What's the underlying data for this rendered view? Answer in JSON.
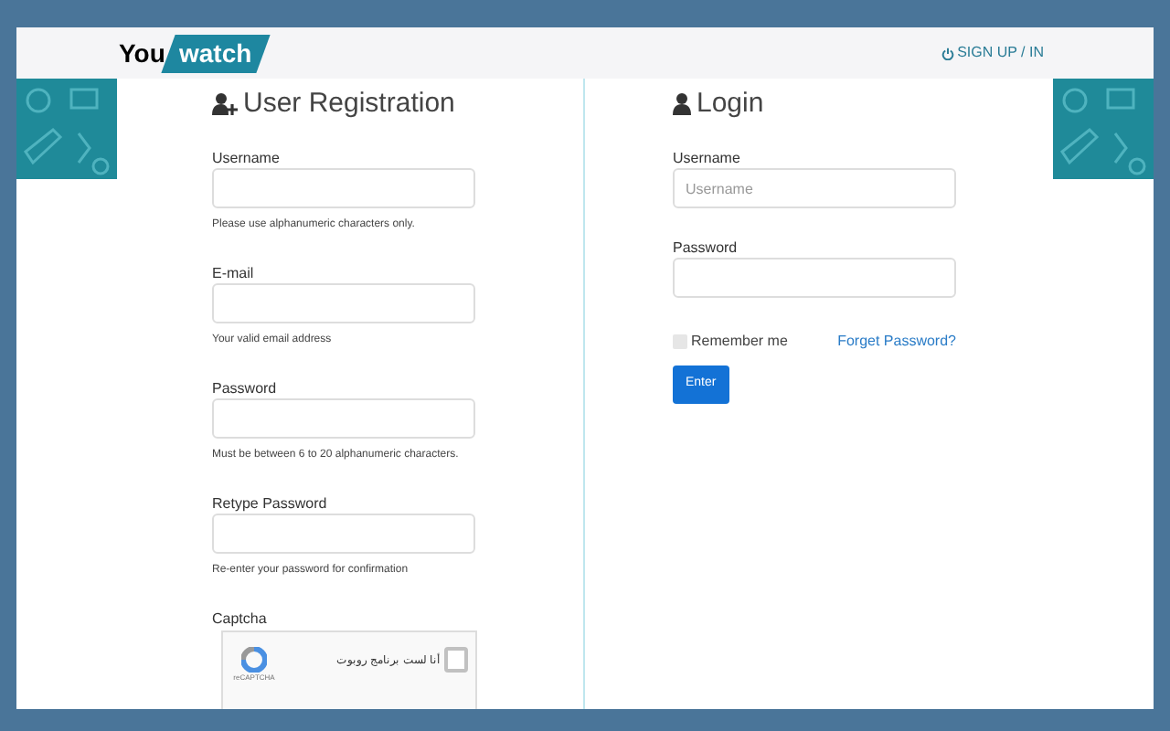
{
  "header": {
    "logo": {
      "part_1": "You",
      "part_2": "watch"
    },
    "signup_link": "SIGN UP / IN"
  },
  "registration": {
    "title": "User Registration",
    "fields": [
      {
        "label": "Username",
        "hint": "Please use alphanumeric characters only."
      },
      {
        "label": "E-mail",
        "hint": "Your valid email address"
      },
      {
        "label": "Password",
        "hint": "Must be between 6 to 20 alphanumeric characters."
      },
      {
        "label": "Retype Password",
        "hint": "Re-enter your password for confirmation"
      }
    ],
    "captcha": {
      "label": "Captcha",
      "text": "أنا لست برنامج روبوت",
      "brand": "reCAPTCHA",
      "checked": false
    }
  },
  "login": {
    "title": "Login",
    "fields": [
      {
        "label": "Username",
        "placeholder": "Username"
      },
      {
        "label": "Password"
      }
    ],
    "remember": {
      "label": "Remember me",
      "checked": false
    },
    "forgot_link": "Forget Password?",
    "submit": "Enter"
  }
}
